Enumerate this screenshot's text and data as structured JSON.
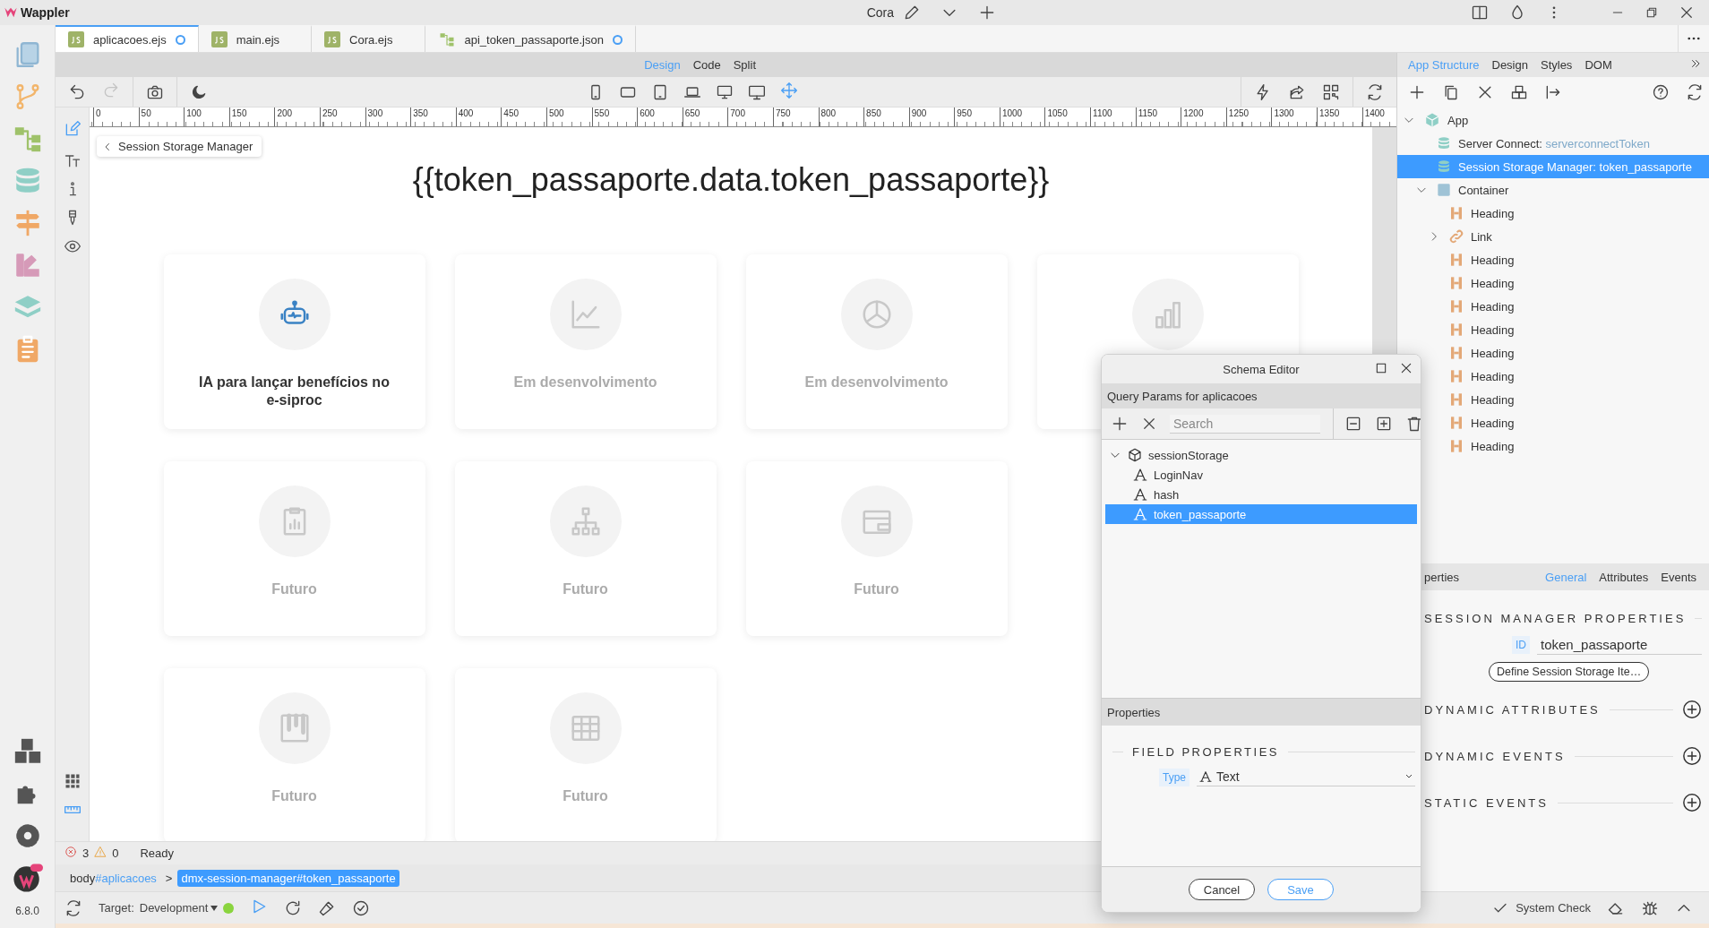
{
  "app": {
    "name": "Wappler",
    "user": "Cora",
    "version": "6.8.0"
  },
  "file_tabs": [
    {
      "label": "aplicacoes.ejs",
      "kind": "js",
      "selected": true,
      "modified": true
    },
    {
      "label": "main.ejs",
      "kind": "js",
      "selected": false,
      "modified": false
    },
    {
      "label": "Cora.ejs",
      "kind": "js",
      "selected": false,
      "modified": false
    },
    {
      "label": "api_token_passaporte.json",
      "kind": "api",
      "selected": false,
      "modified": true
    }
  ],
  "view_modes": [
    {
      "label": "Design",
      "selected": true
    },
    {
      "label": "Code",
      "selected": false
    },
    {
      "label": "Split",
      "selected": false
    }
  ],
  "ruler_labels": [
    "0",
    "50",
    "100",
    "150",
    "200",
    "250",
    "300",
    "350",
    "400",
    "450",
    "500",
    "550",
    "600",
    "650",
    "700",
    "750",
    "800",
    "850",
    "900",
    "950",
    "1000",
    "1050",
    "1100",
    "1150",
    "1200",
    "1250",
    "1300",
    "1350",
    "1400"
  ],
  "canvas": {
    "selection_chip": "Session Storage Manager",
    "heading": "{{token_passaporte.data.token_passaporte}}",
    "card_rows": [
      [
        {
          "label": "IA para lançar benefícios no e-siproc",
          "disabled": false
        },
        {
          "label": "Em desenvolvimento",
          "disabled": true
        },
        {
          "label": "Em desenvolvimento",
          "disabled": true
        },
        {
          "disabled": true
        }
      ],
      [
        {
          "label": "Futuro",
          "disabled": true
        },
        {
          "label": "Futuro",
          "disabled": true
        },
        {
          "label": "Futuro",
          "disabled": true
        }
      ],
      [
        {
          "label": "Futuro",
          "disabled": true
        },
        {
          "label": "Futuro",
          "disabled": true
        }
      ]
    ]
  },
  "status": {
    "errors": "3",
    "warnings": "0",
    "message": "Ready"
  },
  "breadcrumb": [
    {
      "tag": "body",
      "id": "#aplicacoes",
      "selected": false
    },
    {
      "separator": ">",
      "tag": "dmx-session-manager",
      "id": "#token_passaporte",
      "selected": true
    }
  ],
  "bottom_bar": {
    "target_label": "Target:",
    "target": "Development",
    "server_running": true,
    "system_check": "System Check"
  },
  "right_panel": {
    "tabs": [
      {
        "label": "App Structure",
        "selected": true
      },
      {
        "label": "Design",
        "selected": false
      },
      {
        "label": "Styles",
        "selected": false
      },
      {
        "label": "DOM",
        "selected": false
      }
    ],
    "tree": [
      {
        "label": "App",
        "kind": "app",
        "selected": false,
        "expanded": true,
        "children": [
          {
            "label": "Server Connect:",
            "value": "serverconnectToken",
            "kind": "data",
            "selected": false
          },
          {
            "label": "Session Storage Manager:",
            "value": "token_passaporte",
            "kind": "data",
            "selected": true
          },
          {
            "label": "Container",
            "kind": "container",
            "selected": false,
            "expanded": true,
            "children": [
              {
                "label": "Heading",
                "kind": "heading",
                "selected": false
              },
              {
                "label": "Link",
                "kind": "link",
                "selected": false,
                "expanded": false
              },
              {
                "label": "Heading",
                "kind": "heading",
                "selected": false
              },
              {
                "label": "Heading",
                "kind": "heading",
                "selected": false
              },
              {
                "label": "Heading",
                "kind": "heading",
                "selected": false
              },
              {
                "label": "Heading",
                "kind": "heading",
                "selected": false
              },
              {
                "label": "Heading",
                "kind": "heading",
                "selected": false
              },
              {
                "label": "Heading",
                "kind": "heading",
                "selected": false
              },
              {
                "label": "Heading",
                "kind": "heading",
                "selected": false
              },
              {
                "label": "Heading",
                "kind": "heading",
                "selected": false
              },
              {
                "label": "Heading",
                "kind": "heading",
                "selected": false
              }
            ]
          }
        ]
      }
    ],
    "properties": {
      "title": "perties",
      "tabs": [
        {
          "label": "General",
          "selected": true
        },
        {
          "label": "Attributes",
          "selected": false
        },
        {
          "label": "Events",
          "selected": false
        }
      ],
      "section": "SESSION MANAGER PROPERTIES",
      "id_label": "ID",
      "id_value": "token_passaporte",
      "define_button": "Define Session Storage Ite…",
      "sections": [
        "DYNAMIC ATTRIBUTES",
        "DYNAMIC EVENTS",
        "STATIC EVENTS"
      ]
    }
  },
  "schema_editor": {
    "title": "Schema Editor",
    "subtitle": "Query Params for aplicacoes",
    "search": {
      "placeholder": "Search"
    },
    "tree": [
      {
        "label": "sessionStorage",
        "kind": "object",
        "selected": false,
        "expanded": true,
        "children": [
          {
            "label": "LoginNav",
            "kind": "text",
            "selected": false
          },
          {
            "label": "hash",
            "kind": "text",
            "selected": false
          },
          {
            "label": "token_passaporte",
            "kind": "text",
            "selected": true
          }
        ]
      }
    ],
    "properties_title": "Properties",
    "section": "FIELD PROPERTIES",
    "type_label": "Type",
    "type_value": "Text",
    "buttons": [
      "Cancel",
      "Save"
    ]
  }
}
